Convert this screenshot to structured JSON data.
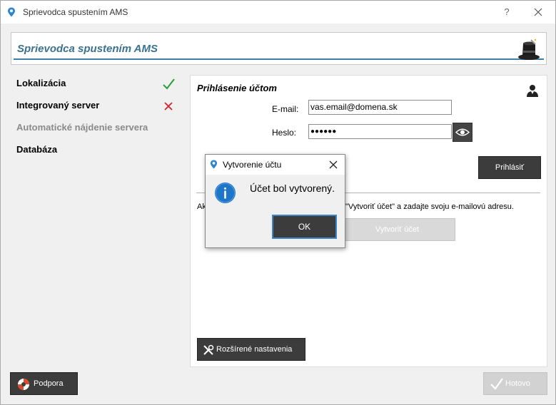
{
  "window": {
    "title": "Sprievodca spustením AMS",
    "help_label": "?"
  },
  "banner": {
    "title": "Sprievodca spustením AMS"
  },
  "steps": [
    {
      "label": "Lokalizácia",
      "status": "success",
      "status_icon": "check-icon"
    },
    {
      "label": "Integrovaný server",
      "status": "error",
      "status_icon": "x-icon"
    },
    {
      "label": "Automatické nájdenie servera",
      "status": "disabled"
    },
    {
      "label": "Databáza",
      "status": "pending"
    }
  ],
  "login": {
    "title": "Prihlásenie účtom",
    "email_label": "E-mail:",
    "email_value": "vas.email@domena.sk",
    "password_label": "Heslo:",
    "password_value": "●●●●●●",
    "login_button": "Prihlásiť",
    "hint_prefix": "Ak",
    "hint_suffix": "\"Vytvoriť účet\" a zadajte svoju e-mailovú adresu.",
    "create_account_button": "Vytvoriť účet",
    "advanced_button": "Rozšírené nastavenia"
  },
  "footer": {
    "support_button": "Podpora",
    "done_button": "Hotovo"
  },
  "dialog": {
    "title": "Vytvorenie účtu",
    "message": "Účet bol vytvorený.",
    "ok_button": "OK"
  },
  "colors": {
    "accent": "#3a7290",
    "banner_line": "#3d7fa3",
    "success": "#2a9d3a",
    "error": "#d9202a",
    "info": "#1f76c8",
    "dark_button": "#3c3c3c",
    "focus_border": "#3d86c6"
  }
}
